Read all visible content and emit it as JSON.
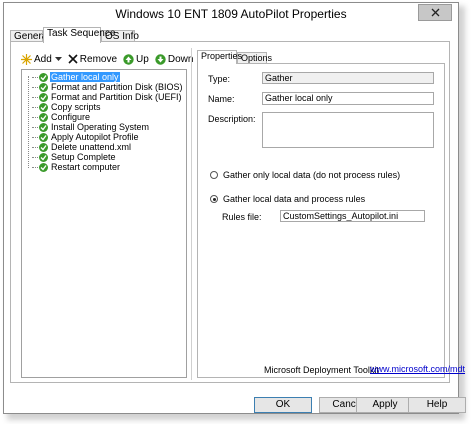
{
  "window": {
    "title": "Windows 10 ENT 1809 AutoPilot Properties"
  },
  "tabs": [
    {
      "label": "General"
    },
    {
      "label": "Task Sequence"
    },
    {
      "label": "OS Info"
    }
  ],
  "toolbar": {
    "add_label": "Add",
    "remove_label": "Remove",
    "up_label": "Up",
    "down_label": "Down"
  },
  "tree": {
    "items": [
      {
        "label": "Gather local only"
      },
      {
        "label": "Format and Partition Disk (BIOS)"
      },
      {
        "label": "Format and Partition Disk (UEFI)"
      },
      {
        "label": "Copy scripts"
      },
      {
        "label": "Configure"
      },
      {
        "label": "Install Operating System"
      },
      {
        "label": "Apply Autopilot Profile"
      },
      {
        "label": "Delete unattend.xml"
      },
      {
        "label": "Setup Complete"
      },
      {
        "label": "Restart computer"
      }
    ]
  },
  "properties": {
    "tabs": [
      {
        "label": "Properties"
      },
      {
        "label": "Options"
      }
    ],
    "type_label": "Type:",
    "type_value": "Gather",
    "name_label": "Name:",
    "name_value": "Gather local only",
    "description_label": "Description:",
    "description_value": "",
    "radio_only_local": "Gather only local data (do not process rules)",
    "radio_process_rules": "Gather local data and process rules",
    "rules_file_label": "Rules file:",
    "rules_file_value": "CustomSettings_Autopilot.ini"
  },
  "footer": {
    "brand": "Microsoft Deployment Toolkit",
    "link": "www.microsoft.com/mdt"
  },
  "buttons": {
    "ok": "OK",
    "cancel": "Cancel",
    "apply": "Apply",
    "help": "Help"
  },
  "colors": {
    "selection": "#3399ff",
    "check_green": "#3a9a2a",
    "link": "#0000cc"
  }
}
